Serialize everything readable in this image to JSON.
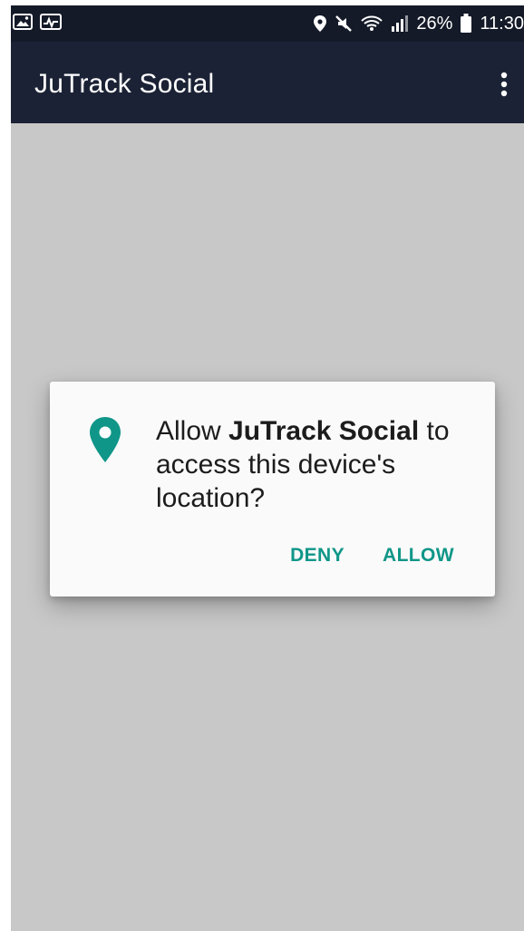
{
  "status_bar": {
    "left_icons": [
      "image-icon",
      "activity-icon"
    ],
    "right_icons": [
      "location-icon",
      "mute-icon",
      "wifi-icon",
      "signal-icon",
      "battery-icon"
    ],
    "battery_percent": "26%",
    "time": "11:30"
  },
  "app_bar": {
    "title": "JuTrack Social",
    "menu_icon": "more-vert-icon"
  },
  "permission_dialog": {
    "icon": "location-pin-icon",
    "message_prefix": "Allow ",
    "app_name": "JuTrack Social",
    "message_suffix": " to access this device's location?",
    "deny_label": "DENY",
    "allow_label": "ALLOW"
  },
  "colors": {
    "status_bar": "#141a28",
    "app_bar": "#1b2235",
    "background": "#c8c8c8",
    "dialog": "#fafafa",
    "accent": "#0f9688"
  }
}
